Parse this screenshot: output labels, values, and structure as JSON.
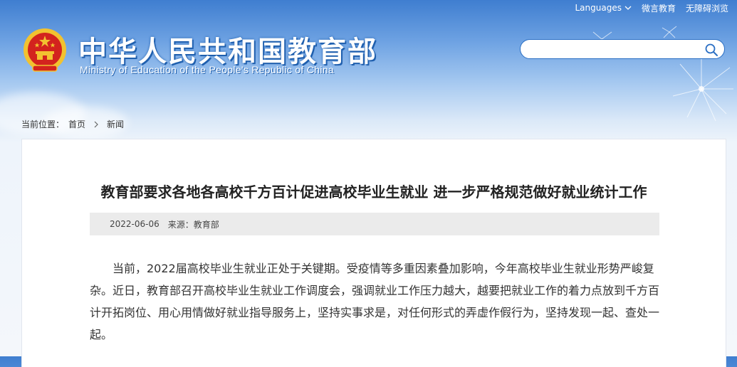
{
  "topbar": {
    "languages": "Languages",
    "weibo": "微言教育",
    "accessibility": "无障碍浏览"
  },
  "header": {
    "title_cn": "中华人民共和国教育部",
    "title_en": "Ministry of Education of the People's Republic of China"
  },
  "search": {
    "placeholder": "",
    "value": ""
  },
  "breadcrumb": {
    "prefix": "当前位置：",
    "home": "首页",
    "current": "新闻"
  },
  "article": {
    "title": "教育部要求各地各高校千方百计促进高校毕业生就业 进一步严格规范做好就业统计工作",
    "date": "2022-06-06",
    "source": "来源：教育部",
    "paragraph": "当前，2022届高校毕业生就业正处于关键期。受疫情等多重因素叠加影响，今年高校毕业生就业形势严峻复杂。近日，教育部召开高校毕业生就业工作调度会，强调就业工作压力越大，越要把就业工作的着力点放到千方百计开拓岗位、用心用情做好就业指导服务上，坚持实事求是，对任何形式的弄虚作假行为，坚持发现一起、查处一起。"
  },
  "colors": {
    "banner_blue": "#3f7ed0",
    "title_shadow": "#1f5fae",
    "search_border": "#2b6fc4",
    "emblem_red": "#d3231e",
    "emblem_gold": "#f2c230"
  },
  "icons": {
    "languages_dropdown": "chevron-down-icon",
    "search": "search-icon",
    "breadcrumb_separator": "chevron-right-icon",
    "logo": "national-emblem-icon"
  }
}
